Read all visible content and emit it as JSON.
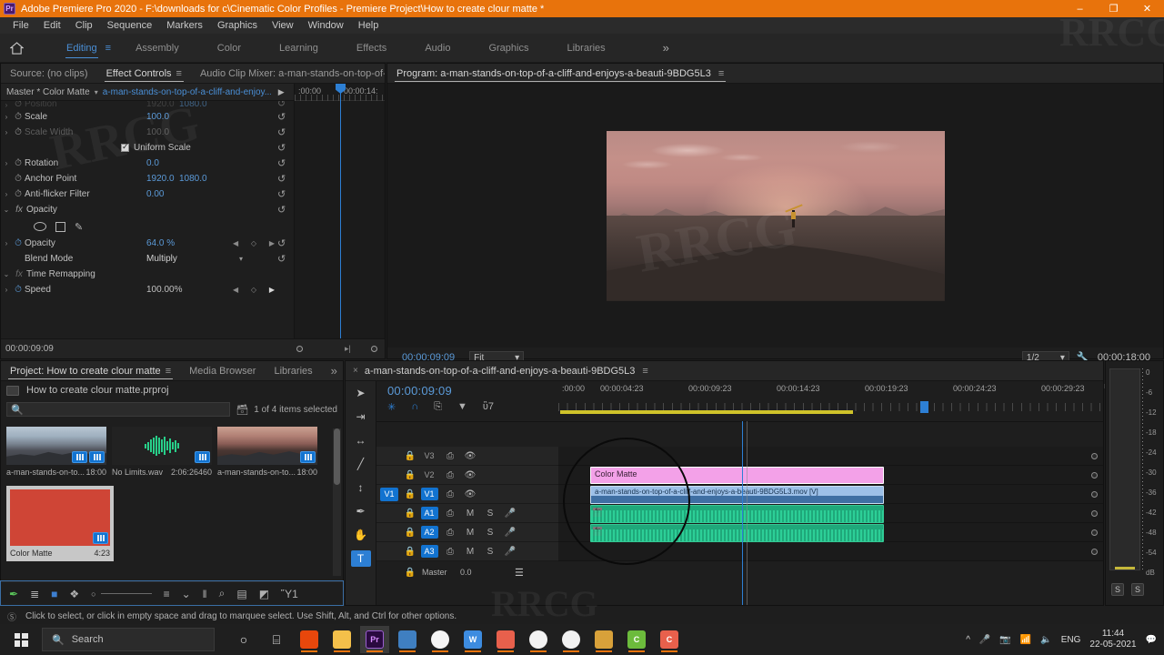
{
  "titlebar": {
    "app_icon": "premiere-pro-logo",
    "title": "Adobe Premiere Pro 2020 - F:\\downloads for c\\Cinematic Color Profiles - Premiere Project\\How to create clour matte *",
    "minimize": "–",
    "maximize": "❐",
    "close": "✕",
    "accent": "#e8730c"
  },
  "menubar": {
    "items": [
      "File",
      "Edit",
      "Clip",
      "Sequence",
      "Markers",
      "Graphics",
      "View",
      "Window",
      "Help"
    ]
  },
  "workspace": {
    "home_icon": "home-icon",
    "menu_icon": "workspace-menu-icon",
    "overflow": "»",
    "tabs": [
      {
        "label": "Editing",
        "active": true
      },
      {
        "label": "Assembly",
        "active": false
      },
      {
        "label": "Color",
        "active": false
      },
      {
        "label": "Learning",
        "active": false
      },
      {
        "label": "Effects",
        "active": false
      },
      {
        "label": "Audio",
        "active": false
      },
      {
        "label": "Graphics",
        "active": false
      },
      {
        "label": "Libraries",
        "active": false
      }
    ],
    "accent": "#4a8fd6"
  },
  "effect_controls": {
    "tabs": [
      {
        "label": "Source: (no clips)",
        "active": false
      },
      {
        "label": "Effect Controls",
        "active": true
      },
      {
        "label": "Audio Clip Mixer: a-man-stands-on-top-of-a-c",
        "active": false
      }
    ],
    "hamburger": "≡",
    "overflow": "»",
    "master_label": "Master * Color Matte",
    "clip_name": "a-man-stands-on-top-of-a-cliff-and-enjoy...",
    "play_icon": "play-icon",
    "ruler_labels": [
      ":00:00",
      "00:00:14:"
    ],
    "playhead_percent": 36,
    "rows": [
      {
        "name": "Position",
        "value": "1920.0",
        "value2": "1080.0",
        "twirl": "›",
        "stopwatch": true,
        "dim": true,
        "reset": true,
        "clipped": true
      },
      {
        "name": "Scale",
        "value": "100.0",
        "value2": "",
        "twirl": "›",
        "stopwatch": true,
        "dim": false,
        "reset": true
      },
      {
        "name": "Scale Width",
        "value": "100.0",
        "value2": "",
        "twirl": "›",
        "stopwatch": true,
        "dim": true,
        "reset": true
      },
      {
        "name": "Uniform Scale",
        "value": "",
        "value2": "",
        "checkbox": true,
        "checked": true,
        "reset": true
      },
      {
        "name": "Rotation",
        "value": "0.0",
        "value2": "",
        "twirl": "›",
        "stopwatch": true,
        "dim": false,
        "reset": true
      },
      {
        "name": "Anchor Point",
        "value": "1920.0",
        "value2": "1080.0",
        "twirl": "",
        "stopwatch": true,
        "dim": false,
        "reset": true
      },
      {
        "name": "Anti-flicker Filter",
        "value": "0.00",
        "value2": "",
        "twirl": "›",
        "stopwatch": true,
        "dim": false,
        "reset": true
      }
    ],
    "opacity_group": {
      "twirl": "⌄",
      "fx": "fx",
      "label": "Opacity",
      "reset": true,
      "mask_tools": [
        "ellipse-mask-icon",
        "rectangle-mask-icon",
        "pen-mask-icon"
      ],
      "opacity_row": {
        "name": "Opacity",
        "value": "64.0 %",
        "twirl": "›",
        "stopwatch": true
      },
      "blend_row": {
        "name": "Blend Mode",
        "value": "Multiply",
        "dropdown": "⌄"
      }
    },
    "time_remapping": {
      "twirl": "⌄",
      "fx": "fx",
      "label": "Time Remapping",
      "speed_row": {
        "name": "Speed",
        "value": "100.00%",
        "twirl": "›",
        "stopwatch": true
      }
    },
    "footer_timecode": "00:00:09:09"
  },
  "program_monitor": {
    "tab_label": "Program: a-man-stands-on-top-of-a-cliff-and-enjoys-a-beauti-9BDG5L3",
    "hamburger": "≡",
    "timecode": "00:00:09:09",
    "zoom_level": "Fit",
    "resolution": "1/2",
    "wrench_icon": "settings-wrench-icon",
    "duration": "00:00:18:00",
    "playhead_percent": 50,
    "transport": [
      {
        "icon": "add-marker-icon",
        "glyph": "▼"
      },
      {
        "icon": "mark-in-icon",
        "glyph": "{"
      },
      {
        "icon": "mark-out-icon",
        "glyph": "}"
      },
      {
        "icon": "go-to-in-icon",
        "glyph": "{←"
      },
      {
        "icon": "step-back-icon",
        "glyph": "◀|"
      },
      {
        "icon": "play-stop-icon",
        "glyph": "▶"
      },
      {
        "icon": "step-forward-icon",
        "glyph": "|▶"
      },
      {
        "icon": "go-to-out-icon",
        "glyph": "→}"
      },
      {
        "icon": "lift-icon",
        "glyph": "⬚"
      },
      {
        "icon": "extract-icon",
        "glyph": "⬚"
      },
      {
        "icon": "export-frame-icon",
        "glyph": "▣"
      },
      {
        "icon": "comparison-view-icon",
        "glyph": "⧉"
      }
    ],
    "button_editor": "+"
  },
  "project_panel": {
    "tabs": [
      {
        "label": "Project: How to create clour matte",
        "active": true
      },
      {
        "label": "Media Browser",
        "active": false
      },
      {
        "label": "Libraries",
        "active": false
      }
    ],
    "hamburger": "≡",
    "overflow": "»",
    "project_file": "How to create clour matte.prproj",
    "search_placeholder": "",
    "search_icon": "search-icon",
    "filter_icon": "filter-bin-icon",
    "selection_status": "1 of 4 items selected",
    "items": [
      {
        "name": "a-man-stands-on-to...",
        "duration": "18:00",
        "kind": "video",
        "selected": false,
        "badge": "video-audio-badge"
      },
      {
        "name": "No Limits.wav",
        "duration": "2:06:26460",
        "kind": "audio",
        "selected": false,
        "badge": "audio-badge"
      },
      {
        "name": "a-man-stands-on-to...",
        "duration": "18:00",
        "kind": "video-warm",
        "selected": false,
        "badge": "video-badge"
      },
      {
        "name": "Color Matte",
        "duration": "4:23",
        "kind": "matte",
        "selected": true,
        "color": "#cf4536",
        "badge": "video-badge"
      }
    ],
    "toolbar": [
      {
        "icon": "pen-tool-icon",
        "glyph": "✒"
      },
      {
        "icon": "list-view-icon",
        "glyph": "≣"
      },
      {
        "icon": "icon-view-icon",
        "glyph": "■"
      },
      {
        "icon": "freeform-view-icon",
        "glyph": "❖"
      },
      {
        "icon": "zoom-slider-icon",
        "glyph": "○"
      },
      {
        "icon": "sort-icon",
        "glyph": "≡"
      },
      {
        "icon": "sort-chevron-icon",
        "glyph": "⌄"
      },
      {
        "icon": "automate-to-sequence-icon",
        "glyph": "‖"
      },
      {
        "icon": "find-icon",
        "glyph": "⌕"
      },
      {
        "icon": "new-bin-icon",
        "glyph": "▤"
      },
      {
        "icon": "new-item-icon",
        "glyph": "◩"
      },
      {
        "icon": "clear-icon",
        "glyph": "Ὕ1"
      }
    ]
  },
  "timeline": {
    "tab_label": "a-man-stands-on-top-of-a-cliff-and-enjoys-a-beauti-9BDG5L3",
    "close_x": "×",
    "hamburger": "≡",
    "timecode": "00:00:09:09",
    "header_icons": [
      {
        "icon": "sequence-settings-icon",
        "glyph": "✳",
        "active": true
      },
      {
        "icon": "snap-icon",
        "glyph": "∩",
        "active": true
      },
      {
        "icon": "linked-selection-icon",
        "glyph": "⎘",
        "active": false
      },
      {
        "icon": "add-marker-icon",
        "glyph": "▼",
        "active": false
      },
      {
        "icon": "timeline-display-settings-icon",
        "glyph": "ὒ7",
        "active": false
      }
    ],
    "tools": [
      {
        "icon": "selection-tool-icon",
        "glyph": "➤",
        "active": false
      },
      {
        "icon": "track-select-forward-tool-icon",
        "glyph": "⇥",
        "active": false
      },
      {
        "icon": "ripple-edit-tool-icon",
        "glyph": "↔",
        "active": false
      },
      {
        "icon": "razor-tool-icon",
        "glyph": "╱",
        "active": false
      },
      {
        "icon": "slip-tool-icon",
        "glyph": "↕",
        "active": false
      },
      {
        "icon": "pen-tool-icon",
        "glyph": "✒",
        "active": false
      },
      {
        "icon": "hand-tool-icon",
        "glyph": "✋",
        "active": false
      },
      {
        "icon": "type-tool-icon",
        "glyph": "T",
        "active": true
      }
    ],
    "ruler_labels": [
      ":00:00",
      "00:00:04:23",
      "00:00:09:23",
      "00:00:14:23",
      "00:00:19:23",
      "00:00:24:23",
      "00:00:29:23"
    ],
    "tracks": [
      {
        "name": "V3",
        "type": "video",
        "targeted": false,
        "lock": "lock-icon",
        "sync": "sync-lock-icon",
        "eye": "eye-icon"
      },
      {
        "name": "V2",
        "type": "video",
        "targeted": false,
        "lock": "lock-icon",
        "sync": "sync-lock-icon",
        "eye": "eye-icon"
      },
      {
        "name": "V1",
        "type": "video",
        "targeted": true,
        "source_patch": "V1",
        "lock": "lock-icon",
        "sync": "sync-lock-icon",
        "eye": "eye-icon"
      },
      {
        "name": "A1",
        "type": "audio",
        "targeted": true,
        "lock": "lock-icon",
        "sync": "sync-lock-icon",
        "mute": "M",
        "solo": "S",
        "mic": "microphone-icon"
      },
      {
        "name": "A2",
        "type": "audio",
        "targeted": true,
        "lock": "lock-icon",
        "sync": "sync-lock-icon",
        "mute": "M",
        "solo": "S",
        "mic": "microphone-icon"
      },
      {
        "name": "A3",
        "type": "audio",
        "targeted": true,
        "lock": "lock-icon",
        "sync": "sync-lock-icon",
        "mute": "M",
        "solo": "S",
        "mic": "microphone-icon"
      }
    ],
    "master_label": "Master",
    "master_value": "0.0",
    "master_icon": "master-meter-icon",
    "clips": {
      "matte": {
        "label": "Color Matte",
        "track": "V2"
      },
      "video": {
        "label": "a-man-stands-on-top-of-a-cliff-and-enjoys-a-beauti-9BDG5L3.mov [V]",
        "track": "V1"
      },
      "audio1": {
        "label": "",
        "track": "A1",
        "fx": "fx"
      },
      "audio2": {
        "label": "",
        "track": "A2",
        "fx": "fx"
      }
    },
    "cursor_icon": "mouse-pointer-icon"
  },
  "audio_meters": {
    "scale": [
      "0",
      "-6",
      "-12",
      "-18",
      "-24",
      "-30",
      "-36",
      "-42",
      "-48",
      "-54",
      "dB"
    ],
    "solo_buttons": [
      "S",
      "S"
    ]
  },
  "statusbar": {
    "icon": "no-drop-icon",
    "text": "Click to select, or click in empty space and drag to marquee select. Use Shift, Alt, and Ctrl for other options."
  },
  "taskbar": {
    "start_icon": "windows-start-icon",
    "search_placeholder": "Search",
    "search_icon": "search-icon",
    "items": [
      {
        "icon": "cortana-icon",
        "glyph": "○",
        "color": "transparent",
        "text": ""
      },
      {
        "icon": "task-view-icon",
        "glyph": "⌸",
        "color": "transparent",
        "text": ""
      },
      {
        "icon": "office-icon",
        "glyph": "",
        "color": "#e8470c",
        "text": ""
      },
      {
        "icon": "file-explorer-icon",
        "glyph": "",
        "color": "#f4c04a",
        "text": ""
      },
      {
        "icon": "premiere-pro-icon",
        "glyph": "Pr",
        "color": "#2a0a40",
        "text": "Pr",
        "active": true
      },
      {
        "icon": "calculator-icon",
        "glyph": "",
        "color": "#3f7fc1",
        "text": ""
      },
      {
        "icon": "chrome-icon",
        "glyph": "",
        "color": "#f5f5f5",
        "text": ""
      },
      {
        "icon": "wps-writer-icon",
        "glyph": "W",
        "color": "#3d8ce0",
        "text": "W"
      },
      {
        "icon": "photos-icon",
        "glyph": "",
        "color": "#e8604c",
        "text": ""
      },
      {
        "icon": "evernote-icon",
        "glyph": "",
        "color": "#f2f2f2",
        "text": ""
      },
      {
        "icon": "evernote-2-icon",
        "glyph": "",
        "color": "#f2f2f2",
        "text": ""
      },
      {
        "icon": "winrar-icon",
        "glyph": "",
        "color": "#d8a13a",
        "text": ""
      },
      {
        "icon": "camtasia-icon",
        "glyph": "C",
        "color": "#6cbb3c",
        "text": "C"
      },
      {
        "icon": "camtasia-editor-icon",
        "glyph": "C",
        "color": "#e8604c",
        "text": "C"
      }
    ],
    "tray": [
      {
        "icon": "show-hidden-icons-chevron",
        "glyph": "∧"
      },
      {
        "icon": "microphone-icon",
        "glyph": "Ἲ4"
      },
      {
        "icon": "camera-icon",
        "glyph": "὏7"
      },
      {
        "icon": "wifi-icon",
        "glyph": "὏6"
      },
      {
        "icon": "volume-icon",
        "glyph": "ὐa"
      }
    ],
    "language": "ENG",
    "time": "11:44",
    "date": "22-05-2021",
    "action_center_icon": "action-center-icon"
  },
  "watermarks": [
    "RRCG",
    "RRCG",
    "RRCG",
    "RRCG"
  ]
}
